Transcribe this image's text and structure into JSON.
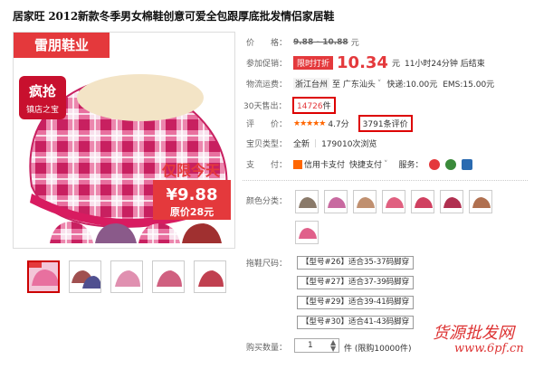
{
  "title": "居家旺 2012新款冬季男女棉鞋创意可爱全包跟厚底批发情侣家居鞋",
  "image": {
    "brand": "雷朋鞋业",
    "badge_line1": "疯抢",
    "badge_line2": "镇店之宝",
    "promo_line": "仅限今天",
    "price": "¥9.88",
    "orig_price": "原价28元"
  },
  "price": {
    "label": "价　　格：",
    "value": "9.88 - 10.88",
    "unit": "元"
  },
  "promo": {
    "label": "参加促销：",
    "tag": "限时打折",
    "price": "10.34",
    "unit": "元",
    "countdown": "11小时24分钟 后结束"
  },
  "shipping": {
    "label": "物流运费：",
    "from": "浙江台州",
    "to": "至 广东汕头",
    "express": "快递:10.00元",
    "ems": "EMS:15.00元"
  },
  "sold": {
    "label": "30天售出：",
    "count": "14726",
    "unit": "件"
  },
  "rating": {
    "label": "评　　价：",
    "stars": "★★★★★",
    "score": "4.7分",
    "reviews": "3791条评价"
  },
  "type": {
    "label": "宝贝类型：",
    "value": "全新",
    "views": "179010次浏览"
  },
  "pay": {
    "label": "支　　付：",
    "card": "信用卡支付",
    "quick": "快捷支付",
    "service_label": "服务："
  },
  "colors_label": "颜色分类：",
  "colors": [
    "#8a7a6a",
    "#c86aa0",
    "#c09070",
    "#e06080",
    "#d04060",
    "#b03050",
    "#e0608a"
  ],
  "sizes_label": "拖鞋尺码：",
  "sizes": [
    "【型号#26】适合35-37码脚穿",
    "【型号#27】适合37-39码脚穿",
    "【型号#29】适合39-41码脚穿",
    "【型号#30】适合41-43码脚穿"
  ],
  "qty": {
    "label": "购买数量：",
    "value": "1",
    "stock": "件 (限购10000件)"
  },
  "watermark": {
    "line1": "货源批发网",
    "line2": "www.6pf.cn"
  }
}
